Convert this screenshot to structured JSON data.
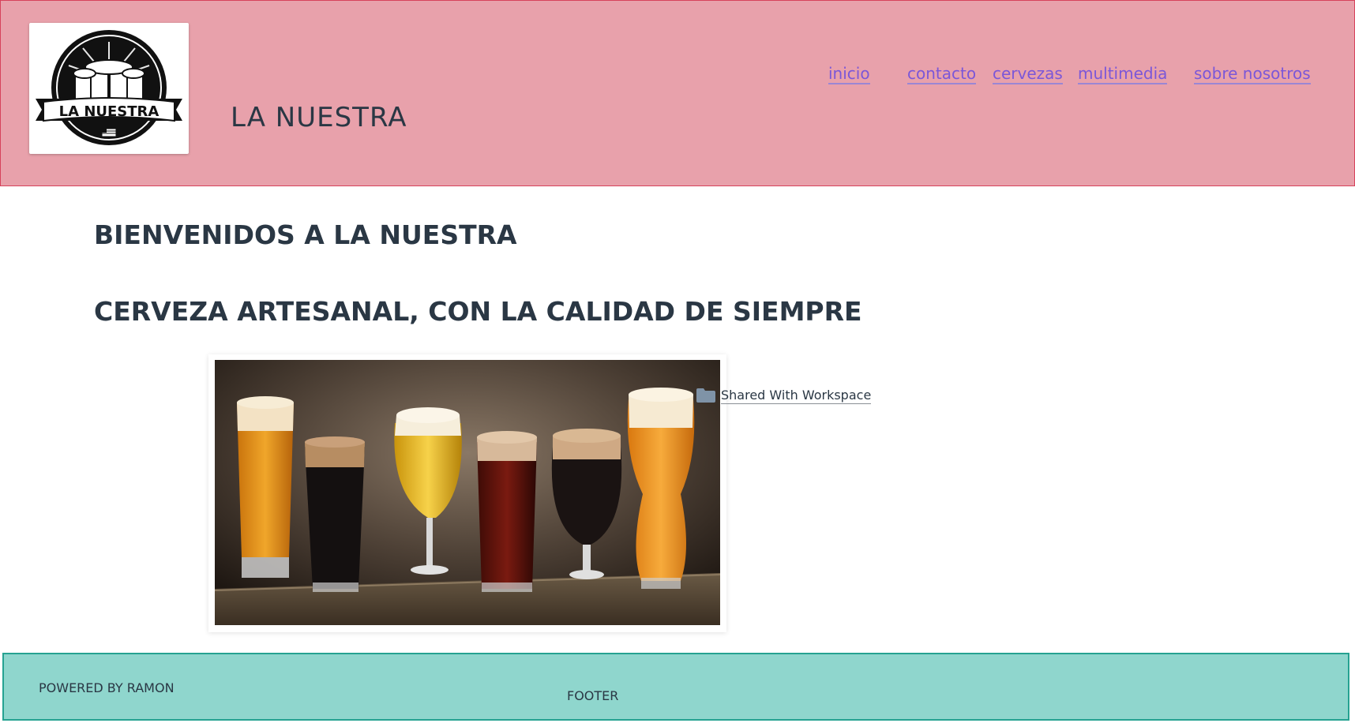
{
  "header": {
    "logo_text": "LA NUESTRA",
    "site_title": "LA NUESTRA",
    "nav": [
      {
        "label": "inicio"
      },
      {
        "label": "contacto"
      },
      {
        "label": "cervezas"
      },
      {
        "label": "multimedia"
      },
      {
        "label": "sobre nosotros"
      }
    ]
  },
  "main": {
    "heading_1": "BIENVENIDOS A LA NUESTRA",
    "heading_2": "CERVEZA ARTESANAL, CON LA CALIDAD DE SIEMPRE",
    "shared_link": {
      "label": "Shared With Workspace",
      "icon": "folder-icon"
    }
  },
  "footer": {
    "powered_by": "POWERED BY RAMON",
    "label": "FOOTER"
  },
  "colors": {
    "header_bg": "#e8a1ab",
    "header_border": "#d6425b",
    "nav_link": "#7b57d8",
    "text": "#2a3744",
    "footer_bg": "#8fd6cd",
    "footer_border": "#26a291"
  }
}
